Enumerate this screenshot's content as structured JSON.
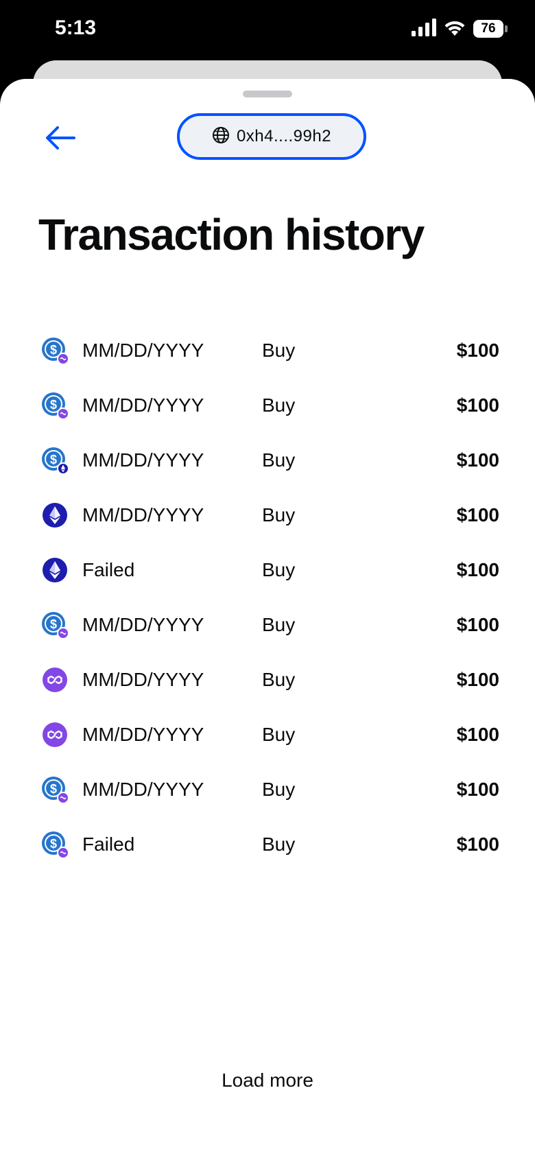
{
  "status_bar": {
    "time": "5:13",
    "battery": "76",
    "icons": [
      "cellular-signal-icon",
      "wifi-icon",
      "battery-icon"
    ]
  },
  "header": {
    "back_icon": "arrow-left-icon",
    "address_icon": "globe-icon",
    "address": "0xh4....99h2"
  },
  "title": "Transaction history",
  "transactions": [
    {
      "asset_icon": "usdc-icon",
      "network_badge": "polygon",
      "date": "MM/DD/YYYY",
      "type": "Buy",
      "amount": "$100"
    },
    {
      "asset_icon": "usdc-icon",
      "network_badge": "polygon",
      "date": "MM/DD/YYYY",
      "type": "Buy",
      "amount": "$100"
    },
    {
      "asset_icon": "usdc-icon",
      "network_badge": "ethereum",
      "date": "MM/DD/YYYY",
      "type": "Buy",
      "amount": "$100"
    },
    {
      "asset_icon": "ethereum-icon",
      "network_badge": "",
      "date": "MM/DD/YYYY",
      "type": "Buy",
      "amount": "$100"
    },
    {
      "asset_icon": "ethereum-icon",
      "network_badge": "",
      "date": "Failed",
      "type": "Buy",
      "amount": "$100"
    },
    {
      "asset_icon": "usdc-icon",
      "network_badge": "polygon",
      "date": "MM/DD/YYYY",
      "type": "Buy",
      "amount": "$100"
    },
    {
      "asset_icon": "polygon-icon",
      "network_badge": "",
      "date": "MM/DD/YYYY",
      "type": "Buy",
      "amount": "$100"
    },
    {
      "asset_icon": "polygon-icon",
      "network_badge": "",
      "date": "MM/DD/YYYY",
      "type": "Buy",
      "amount": "$100"
    },
    {
      "asset_icon": "usdc-icon",
      "network_badge": "polygon",
      "date": "MM/DD/YYYY",
      "type": "Buy",
      "amount": "$100"
    },
    {
      "asset_icon": "usdc-icon",
      "network_badge": "polygon",
      "date": "Failed",
      "type": "Buy",
      "amount": "$100"
    }
  ],
  "load_more": "Load more",
  "colors": {
    "accent": "#0052ff",
    "usdc": "#2775ca",
    "ethereum": "#1d1dae",
    "polygon": "#8247e5",
    "text": "#0a0b0d"
  }
}
